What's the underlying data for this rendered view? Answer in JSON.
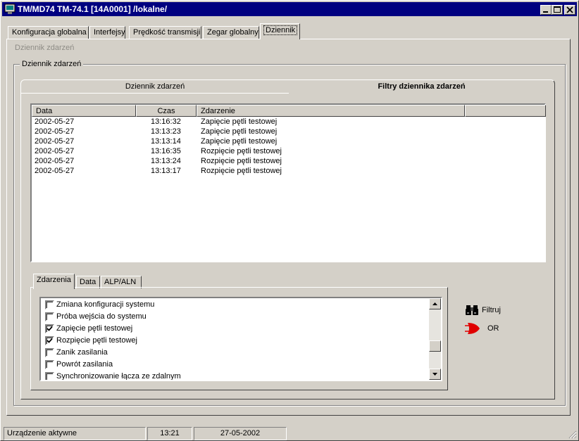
{
  "window": {
    "title": "TM/MD74 TM-74.1 [14A0001] /lokalne/"
  },
  "main_tabs": [
    {
      "label": "Konfiguracja globalna"
    },
    {
      "label": "Interfejsy"
    },
    {
      "label": "Prędkość transmisji"
    },
    {
      "label": "Zegar globalny"
    },
    {
      "label": "Dziennik"
    }
  ],
  "page_label": "Dziennik zdarzeń",
  "group_title": "Dziennik zdarzeń",
  "sub_tabs": [
    {
      "label": "Dziennik zdarzeń"
    },
    {
      "label": "Filtry dziennika zdarzeń"
    }
  ],
  "event_table": {
    "columns": [
      "Data",
      "Czas",
      "Zdarzenie"
    ],
    "rows": [
      {
        "date": "2002-05-27",
        "time": "13:16:32",
        "event": "Zapięcie pętli testowej"
      },
      {
        "date": "2002-05-27",
        "time": "13:13:23",
        "event": "Zapięcie pętli testowej"
      },
      {
        "date": "2002-05-27",
        "time": "13:13:14",
        "event": "Zapięcie pętli testowej"
      },
      {
        "date": "2002-05-27",
        "time": "13:16:35",
        "event": "Rozpięcie pętli testowej"
      },
      {
        "date": "2002-05-27",
        "time": "13:13:24",
        "event": "Rozpięcie pętli testowej"
      },
      {
        "date": "2002-05-27",
        "time": "13:13:17",
        "event": "Rozpięcie pętli testowej"
      }
    ]
  },
  "filter_tabs": [
    {
      "label": "Zdarzenia"
    },
    {
      "label": "Data"
    },
    {
      "label": "ALP/ALN"
    }
  ],
  "filter_items": [
    {
      "label": "Zmiana konfiguracji systemu",
      "checked": false
    },
    {
      "label": "Próba wejścia do systemu",
      "checked": false
    },
    {
      "label": "Zapięcie pętli testowej",
      "checked": true
    },
    {
      "label": "Rozpięcie pętli testowej",
      "checked": true
    },
    {
      "label": "Zanik zasilania",
      "checked": false
    },
    {
      "label": "Powrót zasilania",
      "checked": false
    },
    {
      "label": "Synchronizowanie łącza ze zdalnym",
      "checked": false
    }
  ],
  "actions": {
    "filter_label": "Filtruj",
    "logic_label": "OR"
  },
  "statusbar": {
    "status": "Urządzenie aktywne",
    "time": "13:21",
    "date": "27-05-2002"
  },
  "colors": {
    "titlebar": "#000080",
    "face": "#d4d0c8",
    "logic_gate": "#e00000"
  },
  "icons": {
    "filter": "binoculars-icon",
    "logic": "or-gate-icon"
  }
}
